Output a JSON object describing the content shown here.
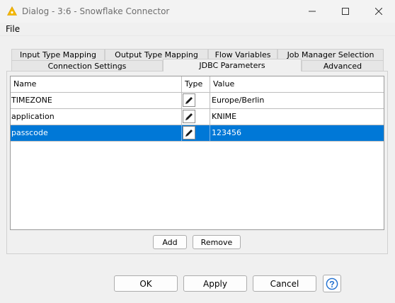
{
  "window": {
    "title": "Dialog - 3:6 - Snowflake Connector",
    "accent_color": "#f5b800"
  },
  "menu": {
    "file": "File"
  },
  "tabs": {
    "row1": [
      "Input Type Mapping",
      "Output Type Mapping",
      "Flow Variables",
      "Job Manager Selection"
    ],
    "row2": [
      "Connection Settings",
      "JDBC Parameters",
      "Advanced"
    ],
    "active": "JDBC Parameters"
  },
  "table": {
    "columns": [
      "Name",
      "Type",
      "Value"
    ],
    "rows": [
      {
        "name": "TIMEZONE",
        "type_icon": "pencil-icon",
        "value": "Europe/Berlin",
        "selected": false
      },
      {
        "name": "application",
        "type_icon": "pencil-icon",
        "value": "KNIME",
        "selected": false
      },
      {
        "name": "passcode",
        "type_icon": "pencil-icon",
        "value": "123456",
        "selected": true
      }
    ],
    "selection_color": "#0078d7"
  },
  "panel_buttons": {
    "add": "Add",
    "remove": "Remove"
  },
  "footer": {
    "ok": "OK",
    "apply": "Apply",
    "cancel": "Cancel",
    "help_icon": "help-icon"
  }
}
